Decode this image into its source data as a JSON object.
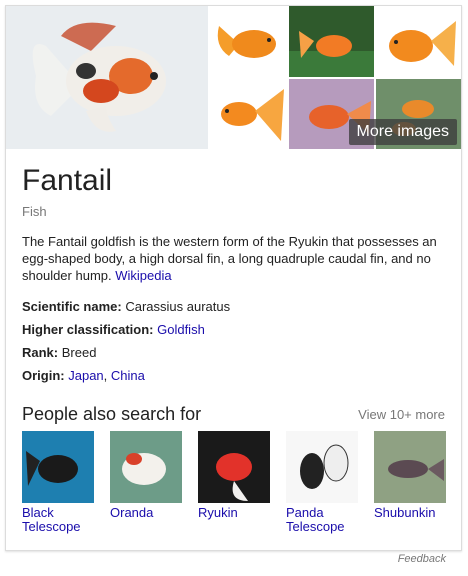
{
  "gallery": {
    "more_images_label": "More images"
  },
  "entity": {
    "title": "Fantail",
    "subtitle": "Fish",
    "description": "The Fantail goldfish is the western form of the Ryukin that possesses an egg-shaped body, a high dorsal fin, a long quadruple caudal fin, and no shoulder hump.",
    "source_link": "Wikipedia"
  },
  "facts": {
    "scientific_name": {
      "label": "Scientific name:",
      "value": "Carassius auratus"
    },
    "higher_classification": {
      "label": "Higher classification:",
      "value": "Goldfish"
    },
    "rank": {
      "label": "Rank:",
      "value": "Breed"
    },
    "origin": {
      "label": "Origin:",
      "values": [
        "Japan",
        "China"
      ],
      "separator": ", "
    }
  },
  "people_also_search": {
    "heading": "People also search for",
    "view_more": "View 10+ more",
    "items": [
      {
        "name": "Black Telescope"
      },
      {
        "name": "Oranda"
      },
      {
        "name": "Ryukin"
      },
      {
        "name": "Panda Telescope"
      },
      {
        "name": "Shubunkin"
      }
    ]
  },
  "footer": {
    "feedback": "Feedback"
  },
  "colors": {
    "link": "#1a0dab",
    "muted": "#777777",
    "text": "#222222"
  }
}
